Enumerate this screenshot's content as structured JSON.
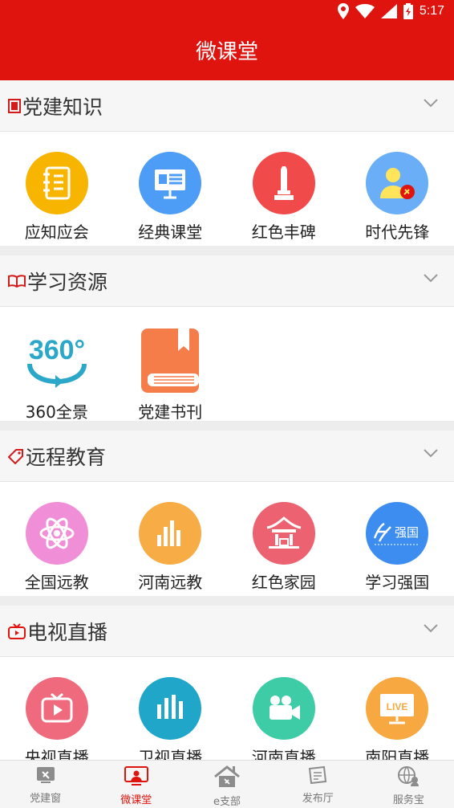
{
  "status": {
    "time": "5:17"
  },
  "header": {
    "title": "微课堂"
  },
  "sections": [
    {
      "title": "党建知识",
      "items": [
        {
          "label": "应知应会",
          "icon": "notebook-icon",
          "color": "#f7b500"
        },
        {
          "label": "经典课堂",
          "icon": "presentation-board-icon",
          "color": "#4d9cf5"
        },
        {
          "label": "红色丰碑",
          "icon": "monument-icon",
          "color": "#f04a4a"
        },
        {
          "label": "时代先锋",
          "icon": "pioneer-person-icon",
          "color": "#6aaef7"
        }
      ]
    },
    {
      "title": "学习资源",
      "items": [
        {
          "label": "360全景",
          "icon": "panorama-360-icon",
          "color": "#2aa7c9"
        },
        {
          "label": "党建书刊",
          "icon": "book-icon",
          "color": "#f47d4a"
        }
      ]
    },
    {
      "title": "远程教育",
      "items": [
        {
          "label": "全国远教",
          "icon": "atom-icon",
          "color": "#f08ed7"
        },
        {
          "label": "河南远教",
          "icon": "bar-city-icon",
          "color": "#f8ac45"
        },
        {
          "label": "红色家园",
          "icon": "pavilion-icon",
          "color": "#ec6271"
        },
        {
          "label": "学习强国",
          "icon": "xuexi-qiangguo-logo",
          "color": "#3d8df0",
          "logo_text": "强国"
        }
      ]
    },
    {
      "title": "电视直播",
      "items": [
        {
          "label": "央视直播",
          "icon": "tv-play-icon",
          "color": "#ee6a7c"
        },
        {
          "label": "卫视直播",
          "icon": "audio-bars-icon",
          "color": "#1fa6c9"
        },
        {
          "label": "河南直播",
          "icon": "video-camera-icon",
          "color": "#3dcca6"
        },
        {
          "label": "南阳直播",
          "icon": "live-screen-icon",
          "color": "#f7a841",
          "badge": "LIVE"
        }
      ]
    }
  ],
  "bottom_nav": [
    {
      "label": "党建窗",
      "icon": "party-window-icon",
      "active": false
    },
    {
      "label": "微课堂",
      "icon": "micro-class-icon",
      "active": true
    },
    {
      "label": "e支部",
      "icon": "branch-house-icon",
      "active": false
    },
    {
      "label": "发布厅",
      "icon": "publish-hall-icon",
      "active": false
    },
    {
      "label": "服务宝",
      "icon": "service-globe-icon",
      "active": false
    }
  ],
  "colors": {
    "brand_red": "#e0140f",
    "text": "#333333",
    "nav_inactive": "#777777"
  }
}
